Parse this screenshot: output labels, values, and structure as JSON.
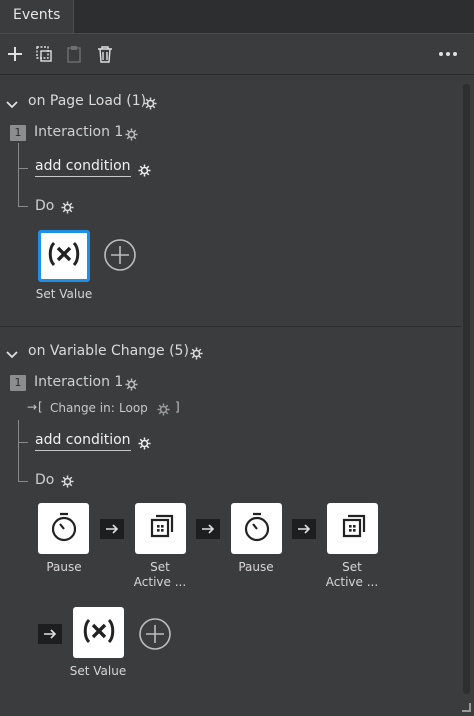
{
  "tab": {
    "label": "Events"
  },
  "sections": [
    {
      "title": "on Page Load (1)",
      "interaction": {
        "number": "1",
        "label": "Interaction 1"
      },
      "add_condition": "add condition",
      "do_label": "Do",
      "actions": [
        {
          "label": "Set Value",
          "icon": "variable-x-icon"
        }
      ]
    },
    {
      "title": "on Variable Change (5)",
      "interaction": {
        "number": "1",
        "label": "Interaction 1"
      },
      "change_in": {
        "prefix": "Change in:",
        "value": "Loop"
      },
      "add_condition": "add condition",
      "do_label": "Do",
      "actions": [
        {
          "label": "Pause",
          "icon": "timer-icon"
        },
        {
          "label_line1": "Set",
          "label_line2": "Active ...",
          "icon": "state-icon"
        },
        {
          "label": "Pause",
          "icon": "timer-icon"
        },
        {
          "label_line1": "Set",
          "label_line2": "Active ...",
          "icon": "state-icon"
        },
        {
          "label": "Set Value",
          "icon": "variable-x-icon"
        }
      ]
    }
  ],
  "colors": {
    "background": "#3b3c3e",
    "selected_border": "#1e8fe6",
    "arrow_bg": "#1d1e20"
  }
}
